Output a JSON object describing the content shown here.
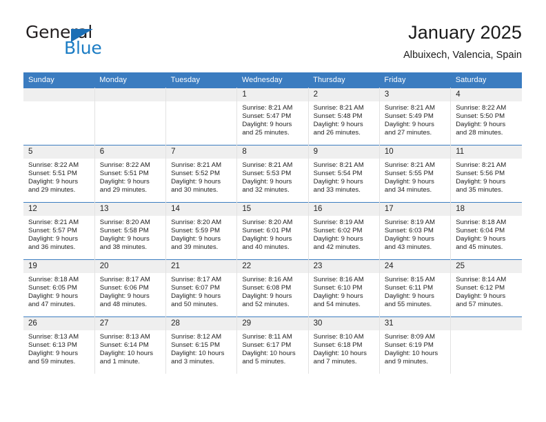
{
  "brand": {
    "name_top": "General",
    "name_bottom": "Blue",
    "triangle_color": "#1b6eb5",
    "blue_color": "#1b7cc4"
  },
  "header": {
    "title": "January 2025",
    "location": "Albuixech, Valencia, Spain"
  },
  "theme": {
    "header_blue": "#3b7cc0",
    "daynum_band": "#efefef",
    "text": "#222222"
  },
  "calendar": {
    "weekday_headers": [
      "Sunday",
      "Monday",
      "Tuesday",
      "Wednesday",
      "Thursday",
      "Friday",
      "Saturday"
    ],
    "weeks": [
      [
        {
          "day": "",
          "lines": []
        },
        {
          "day": "",
          "lines": []
        },
        {
          "day": "",
          "lines": []
        },
        {
          "day": "1",
          "lines": [
            "Sunrise: 8:21 AM",
            "Sunset: 5:47 PM",
            "Daylight: 9 hours",
            "and 25 minutes."
          ]
        },
        {
          "day": "2",
          "lines": [
            "Sunrise: 8:21 AM",
            "Sunset: 5:48 PM",
            "Daylight: 9 hours",
            "and 26 minutes."
          ]
        },
        {
          "day": "3",
          "lines": [
            "Sunrise: 8:21 AM",
            "Sunset: 5:49 PM",
            "Daylight: 9 hours",
            "and 27 minutes."
          ]
        },
        {
          "day": "4",
          "lines": [
            "Sunrise: 8:22 AM",
            "Sunset: 5:50 PM",
            "Daylight: 9 hours",
            "and 28 minutes."
          ]
        }
      ],
      [
        {
          "day": "5",
          "lines": [
            "Sunrise: 8:22 AM",
            "Sunset: 5:51 PM",
            "Daylight: 9 hours",
            "and 29 minutes."
          ]
        },
        {
          "day": "6",
          "lines": [
            "Sunrise: 8:22 AM",
            "Sunset: 5:51 PM",
            "Daylight: 9 hours",
            "and 29 minutes."
          ]
        },
        {
          "day": "7",
          "lines": [
            "Sunrise: 8:21 AM",
            "Sunset: 5:52 PM",
            "Daylight: 9 hours",
            "and 30 minutes."
          ]
        },
        {
          "day": "8",
          "lines": [
            "Sunrise: 8:21 AM",
            "Sunset: 5:53 PM",
            "Daylight: 9 hours",
            "and 32 minutes."
          ]
        },
        {
          "day": "9",
          "lines": [
            "Sunrise: 8:21 AM",
            "Sunset: 5:54 PM",
            "Daylight: 9 hours",
            "and 33 minutes."
          ]
        },
        {
          "day": "10",
          "lines": [
            "Sunrise: 8:21 AM",
            "Sunset: 5:55 PM",
            "Daylight: 9 hours",
            "and 34 minutes."
          ]
        },
        {
          "day": "11",
          "lines": [
            "Sunrise: 8:21 AM",
            "Sunset: 5:56 PM",
            "Daylight: 9 hours",
            "and 35 minutes."
          ]
        }
      ],
      [
        {
          "day": "12",
          "lines": [
            "Sunrise: 8:21 AM",
            "Sunset: 5:57 PM",
            "Daylight: 9 hours",
            "and 36 minutes."
          ]
        },
        {
          "day": "13",
          "lines": [
            "Sunrise: 8:20 AM",
            "Sunset: 5:58 PM",
            "Daylight: 9 hours",
            "and 38 minutes."
          ]
        },
        {
          "day": "14",
          "lines": [
            "Sunrise: 8:20 AM",
            "Sunset: 5:59 PM",
            "Daylight: 9 hours",
            "and 39 minutes."
          ]
        },
        {
          "day": "15",
          "lines": [
            "Sunrise: 8:20 AM",
            "Sunset: 6:01 PM",
            "Daylight: 9 hours",
            "and 40 minutes."
          ]
        },
        {
          "day": "16",
          "lines": [
            "Sunrise: 8:19 AM",
            "Sunset: 6:02 PM",
            "Daylight: 9 hours",
            "and 42 minutes."
          ]
        },
        {
          "day": "17",
          "lines": [
            "Sunrise: 8:19 AM",
            "Sunset: 6:03 PM",
            "Daylight: 9 hours",
            "and 43 minutes."
          ]
        },
        {
          "day": "18",
          "lines": [
            "Sunrise: 8:18 AM",
            "Sunset: 6:04 PM",
            "Daylight: 9 hours",
            "and 45 minutes."
          ]
        }
      ],
      [
        {
          "day": "19",
          "lines": [
            "Sunrise: 8:18 AM",
            "Sunset: 6:05 PM",
            "Daylight: 9 hours",
            "and 47 minutes."
          ]
        },
        {
          "day": "20",
          "lines": [
            "Sunrise: 8:17 AM",
            "Sunset: 6:06 PM",
            "Daylight: 9 hours",
            "and 48 minutes."
          ]
        },
        {
          "day": "21",
          "lines": [
            "Sunrise: 8:17 AM",
            "Sunset: 6:07 PM",
            "Daylight: 9 hours",
            "and 50 minutes."
          ]
        },
        {
          "day": "22",
          "lines": [
            "Sunrise: 8:16 AM",
            "Sunset: 6:08 PM",
            "Daylight: 9 hours",
            "and 52 minutes."
          ]
        },
        {
          "day": "23",
          "lines": [
            "Sunrise: 8:16 AM",
            "Sunset: 6:10 PM",
            "Daylight: 9 hours",
            "and 54 minutes."
          ]
        },
        {
          "day": "24",
          "lines": [
            "Sunrise: 8:15 AM",
            "Sunset: 6:11 PM",
            "Daylight: 9 hours",
            "and 55 minutes."
          ]
        },
        {
          "day": "25",
          "lines": [
            "Sunrise: 8:14 AM",
            "Sunset: 6:12 PM",
            "Daylight: 9 hours",
            "and 57 minutes."
          ]
        }
      ],
      [
        {
          "day": "26",
          "lines": [
            "Sunrise: 8:13 AM",
            "Sunset: 6:13 PM",
            "Daylight: 9 hours",
            "and 59 minutes."
          ]
        },
        {
          "day": "27",
          "lines": [
            "Sunrise: 8:13 AM",
            "Sunset: 6:14 PM",
            "Daylight: 10 hours",
            "and 1 minute."
          ]
        },
        {
          "day": "28",
          "lines": [
            "Sunrise: 8:12 AM",
            "Sunset: 6:15 PM",
            "Daylight: 10 hours",
            "and 3 minutes."
          ]
        },
        {
          "day": "29",
          "lines": [
            "Sunrise: 8:11 AM",
            "Sunset: 6:17 PM",
            "Daylight: 10 hours",
            "and 5 minutes."
          ]
        },
        {
          "day": "30",
          "lines": [
            "Sunrise: 8:10 AM",
            "Sunset: 6:18 PM",
            "Daylight: 10 hours",
            "and 7 minutes."
          ]
        },
        {
          "day": "31",
          "lines": [
            "Sunrise: 8:09 AM",
            "Sunset: 6:19 PM",
            "Daylight: 10 hours",
            "and 9 minutes."
          ]
        },
        {
          "day": "",
          "lines": []
        }
      ]
    ]
  }
}
